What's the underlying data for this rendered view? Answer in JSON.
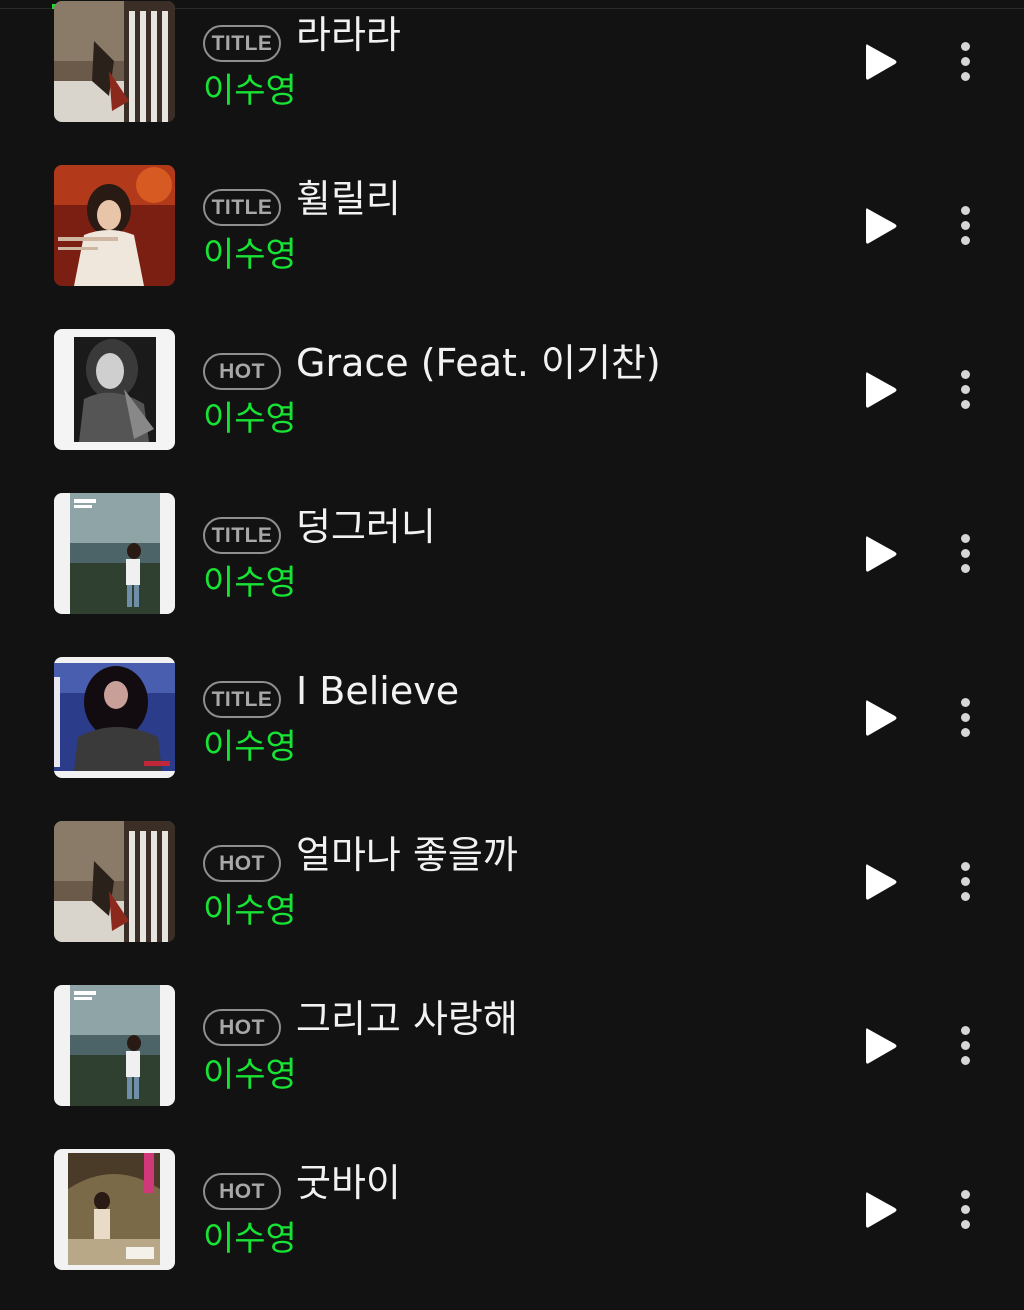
{
  "tracks": [
    {
      "badge": "TITLE",
      "title": "라라라",
      "artist": "이수영",
      "cover": "album-lalala-cover"
    },
    {
      "badge": "TITLE",
      "title": "휠릴리",
      "artist": "이수영",
      "cover": "album-whillili-cover"
    },
    {
      "badge": "HOT",
      "title": "Grace (Feat. 이기찬)",
      "artist": "이수영",
      "cover": "album-grace-cover"
    },
    {
      "badge": "TITLE",
      "title": "덩그러니",
      "artist": "이수영",
      "cover": "album-lee-soo-young-cover"
    },
    {
      "badge": "TITLE",
      "title": "I Believe",
      "artist": "이수영",
      "cover": "album-i-believe-cover"
    },
    {
      "badge": "HOT",
      "title": "얼마나 좋을까",
      "artist": "이수영",
      "cover": "album-lalala-cover"
    },
    {
      "badge": "HOT",
      "title": "그리고 사랑해",
      "artist": "이수영",
      "cover": "album-lee-soo-young-cover"
    },
    {
      "badge": "HOT",
      "title": "굿바이",
      "artist": "이수영",
      "cover": "album-goodbye-cover"
    }
  ],
  "icons": {
    "play": "play-icon",
    "more": "more-vertical-icon"
  },
  "colors": {
    "background": "#121212",
    "accent": "#17e335",
    "title_text": "#f2f2f2",
    "badge_border": "#8f8f8f"
  }
}
